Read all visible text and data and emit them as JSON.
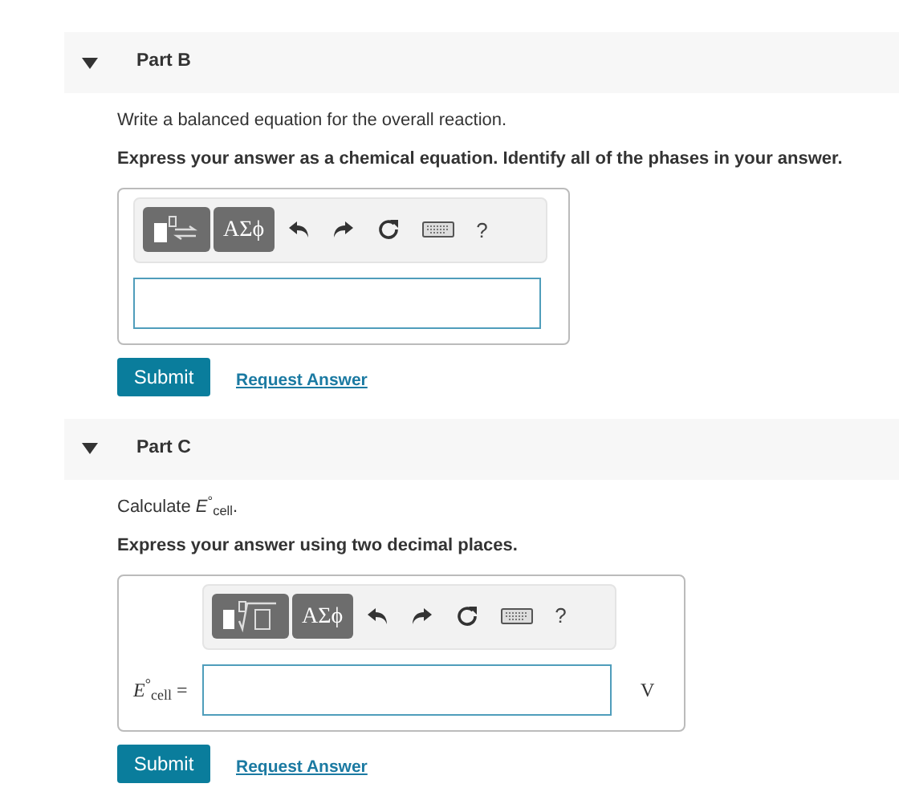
{
  "parts": [
    {
      "title": "Part B",
      "expanded": true,
      "prompt": "Write a balanced equation for the overall reaction.",
      "instruction": "Express your answer as a chemical equation. Identify all of the phases in your answer.",
      "toolbar": {
        "kind": "equation",
        "symbols": "ΑΣϕ",
        "help": "?"
      },
      "answer": {
        "kind": "equation"
      },
      "submit": "Submit",
      "request": "Request Answer"
    },
    {
      "title": "Part C",
      "expanded": true,
      "prompt": "Calculate *E*$^{°}$$_{cell}$.",
      "instruction": "Express your answer using two decimal places.",
      "toolbar": {
        "kind": "root",
        "symbols": "ΑΣϕ",
        "help": "?"
      },
      "answer": {
        "kind": "value",
        "label": "*E*$^{°}$$_{cell}$ =",
        "unit": "V"
      },
      "submit": "Submit",
      "request": "Request Answer"
    }
  ]
}
